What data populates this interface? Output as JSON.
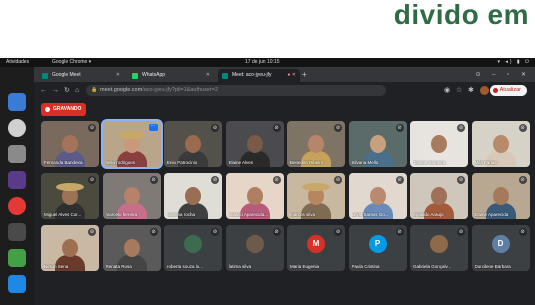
{
  "headline": "divido em",
  "desktop": {
    "activities": "Atividades",
    "app_menu": "Google Chrome ▾",
    "clock": "17 de jun  10:15"
  },
  "browser": {
    "tabs": [
      {
        "label": "Google Meet",
        "favicon_color": "#00897b",
        "active": false
      },
      {
        "label": "WhatsApp",
        "favicon_color": "#25d366",
        "active": false
      },
      {
        "label": "Meet: aco-jyeu-jfy",
        "favicon_color": "#00897b",
        "active": true
      }
    ],
    "url_host": "meet.google.com",
    "url_path": "/aco-jyeu-jfy?pli=1&authuser=2",
    "update_label": "Atualizar"
  },
  "meet": {
    "recording_label": "GRAVANDO",
    "participants": [
      {
        "name": "Fernanda Bandeira",
        "type": "video",
        "bg": "#7a6a5e",
        "skin": "#a57458",
        "shirt": "#5b5b8a"
      },
      {
        "name": "helio rodrigues",
        "type": "video",
        "bg": "#b9a58a",
        "skin": "#c99a7a",
        "shirt": "#8a3f3f",
        "focused": true,
        "hat": true
      },
      {
        "name": "Enio Patrocinio",
        "type": "video",
        "bg": "#54504a",
        "skin": "#9a6b4c",
        "shirt": "#3a3a3a"
      },
      {
        "name": "Elaine Alves",
        "type": "video",
        "bg": "#4b4b4f",
        "skin": "#7a5a48",
        "shirt": "#2a2a2a"
      },
      {
        "name": "Benedita Ribeiro",
        "type": "video",
        "bg": "#7d7466",
        "skin": "#b7866a",
        "shirt": "#c6a15a"
      },
      {
        "name": "Silvana Mello",
        "type": "video",
        "bg": "#5a6b6a",
        "skin": "#c7a07e",
        "shirt": "#4a6f8a"
      },
      {
        "name": "Tatiane Siqueira",
        "type": "video",
        "bg": "#e7e3df",
        "skin": "#a87a5e",
        "shirt": "#e9e4e0"
      },
      {
        "name": "Mila Farias",
        "type": "video",
        "bg": "#d7d2c8",
        "skin": "#b78a68",
        "shirt": "#d8c8b8"
      },
      {
        "name": "Miguel Alves Cor...",
        "type": "video",
        "bg": "#4a4a3f",
        "skin": "#9d7355",
        "shirt": "#2f2f2f",
        "hat": true
      },
      {
        "name": "marcelo ferreira",
        "type": "video",
        "bg": "#7f7a76",
        "skin": "#b6826a",
        "shirt": "#c76e8a"
      },
      {
        "name": "josefina rocha",
        "type": "video",
        "bg": "#e0dcd6",
        "skin": "#9a6e52",
        "shirt": "#3f3f3f"
      },
      {
        "name": "Valdeci Aparecida...",
        "type": "video",
        "bg": "#e6d6c8",
        "skin": "#b07e62",
        "shirt": "#b85a7a"
      },
      {
        "name": "marcos silva",
        "type": "video",
        "bg": "#c8b8a0",
        "skin": "#b6865e",
        "shirt": "#7f6a52",
        "hat": true
      },
      {
        "name": "Leyla Santos Go...",
        "type": "video",
        "bg": "#e1d8cf",
        "skin": "#b98a70",
        "shirt": "#6a8ab8"
      },
      {
        "name": "Agnaldo Araujo",
        "type": "video",
        "bg": "#cfc6bc",
        "skin": "#a07058",
        "shirt": "#a35a3a"
      },
      {
        "name": "Elaine Aparecida",
        "type": "video",
        "bg": "#b8a892",
        "skin": "#a57a5a",
        "shirt": "#3a5a7a"
      },
      {
        "name": "Nilson Sena",
        "type": "video",
        "bg": "#c9b9a4",
        "skin": "#9e7050",
        "shirt": "#6a3a2a"
      },
      {
        "name": "Renata Rosa",
        "type": "video",
        "bg": "#5a5a5a",
        "skin": "#a57a5e",
        "shirt": "#444"
      },
      {
        "name": "roberta souza lo...",
        "type": "avatar",
        "initial": "",
        "color": "#3d6b4f"
      },
      {
        "name": "fatima silva",
        "type": "avatar",
        "initial": "",
        "color": "#6d5a4a"
      },
      {
        "name": "Maria Eugenia",
        "type": "avatar",
        "initial": "M",
        "color": "#d93025"
      },
      {
        "name": "Paula Cristina",
        "type": "avatar",
        "initial": "P",
        "color": "#039be5"
      },
      {
        "name": "Gabriela Gonçalv...",
        "type": "avatar",
        "initial": "",
        "color": "#8e6a4a"
      },
      {
        "name": "Durcilene Barbara",
        "type": "avatar",
        "initial": "D",
        "color": "#5f7ea4"
      }
    ]
  }
}
